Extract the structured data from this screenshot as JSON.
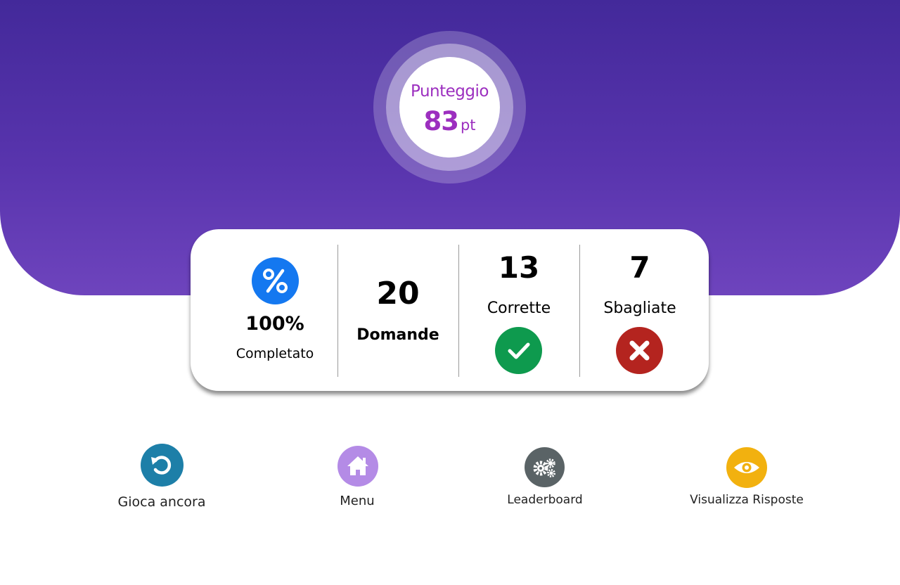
{
  "score": {
    "label": "Punteggio",
    "value": "83",
    "unit": "pt"
  },
  "stats": {
    "completion": {
      "value": "100%",
      "label": "Completato",
      "icon": "percent-icon"
    },
    "questions": {
      "value": "20",
      "label": "Domande"
    },
    "correct": {
      "value": "13",
      "label": "Corrette",
      "icon": "check-icon"
    },
    "wrong": {
      "value": "7",
      "label": "Sbagliate",
      "icon": "cross-icon"
    }
  },
  "actions": {
    "play_again": {
      "label": "Gioca ancora",
      "icon": "replay-icon",
      "color": "#1d7fa8"
    },
    "menu": {
      "label": "Menu",
      "icon": "home-icon",
      "color": "#b48be6"
    },
    "leaderboard": {
      "label": "Leaderboard",
      "icon": "gears-icon",
      "color": "#5a6366"
    },
    "view_answers": {
      "label": "Visualizza Risposte",
      "icon": "eye-icon",
      "color": "#f2b10f"
    }
  },
  "colors": {
    "header_gradient_top": "#43299a",
    "header_gradient_bottom": "#6e44bd",
    "score_text": "#9c2fbf",
    "percent_badge": "#1478f0",
    "correct_badge": "#0e9a4e",
    "wrong_badge": "#b4241f"
  }
}
